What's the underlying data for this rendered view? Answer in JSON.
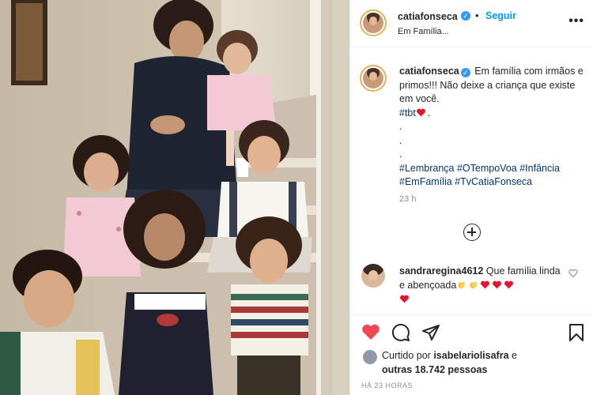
{
  "post": {
    "username": "catiafonseca",
    "verified_mark": "✓",
    "separator": "•",
    "follow_label": "Seguir",
    "location": "Em Família...",
    "more_label": "•••"
  },
  "caption": {
    "username": "catiafonseca",
    "text": "Em família com irmãos e primos!!! Não deixe a criança que existe em você.",
    "hashtag_tbt": "#tbt",
    "dots": ".",
    "hashtags": [
      "#Lembrança",
      "#OTempoVoa",
      "#Infância",
      "#EmFamília",
      "#TvCatiaFonseca"
    ],
    "time": "23 h"
  },
  "comment": {
    "username": "sandraregina4612",
    "text": "Que família linda e abençoada",
    "emojis": [
      "clap",
      "clap",
      "heart",
      "heart",
      "heart",
      "heart"
    ]
  },
  "likes": {
    "prefix": "Curtido por",
    "user": "isabelariolisafra",
    "connector": "e",
    "others": "outras 18.742 pessoas"
  },
  "timestamp": "HÁ 23 HORAS",
  "colors": {
    "accent_blue": "#0095f6",
    "verified_blue": "#3897f0",
    "hashtag_blue": "#00376b",
    "like_red": "#ed4956",
    "muted_gray": "#8e8e8e"
  },
  "icons": {
    "like": "heart-filled-icon",
    "comment": "comment-icon",
    "share": "paper-plane-icon",
    "save": "bookmark-icon",
    "load_more": "plus-circle-icon",
    "comment_like": "heart-outline-icon"
  }
}
